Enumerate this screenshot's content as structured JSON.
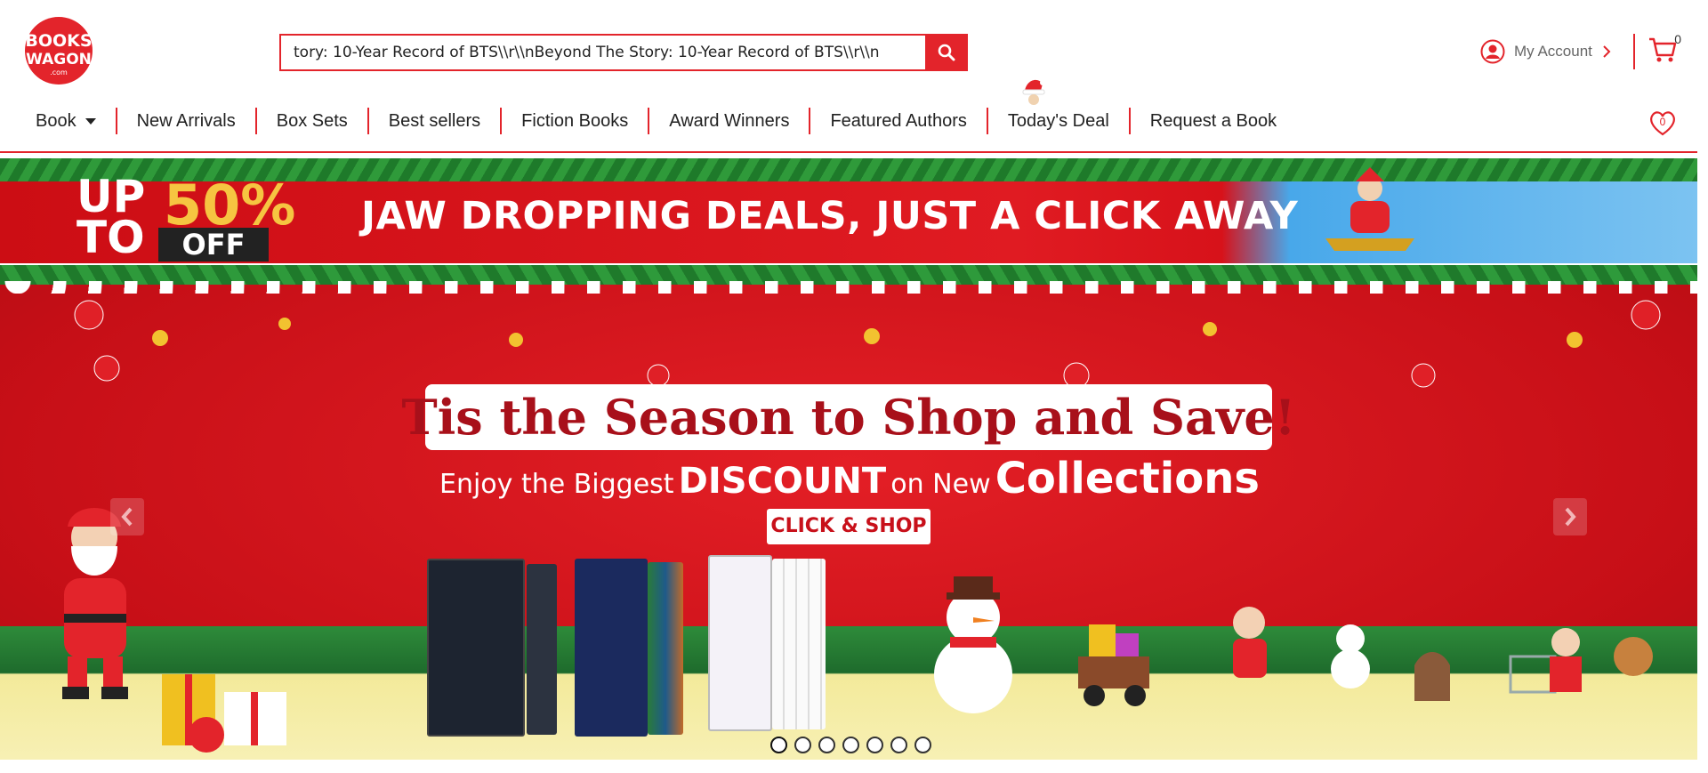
{
  "header": {
    "logo_text": "BOOKS WAGON .com",
    "search_value": "tory: 10-Year Record of BTS\\\\r\\\\nBeyond The Story: 10-Year Record of BTS\\\\r\\\\n",
    "account_label": "My Account",
    "cart_count": "0",
    "wishlist_count": "0"
  },
  "nav": {
    "items": [
      "Book",
      "New Arrivals",
      "Box Sets",
      "Best sellers",
      "Fiction Books",
      "Award Winners",
      "Featured Authors",
      "Today's Deal",
      "Request a Book"
    ]
  },
  "promo": {
    "up": "UP",
    "to": "TO",
    "percent": "50%",
    "off": "OFF",
    "headline": "JAW DROPPING DEALS, JUST A CLICK AWAY"
  },
  "hero": {
    "title": "Tis the Season to Shop and Save!",
    "sub_a": "Enjoy the Biggest",
    "sub_b": "DISCOUNT",
    "sub_c": "on New",
    "sub_d": "Collections",
    "cta": "CLICK & SHOP",
    "slide_count": 7,
    "active_slide": 1
  },
  "colors": {
    "brand_red": "#e3242b",
    "hero_red": "#c70f17",
    "gold": "#f6c541"
  },
  "icons": [
    "search-icon",
    "user-icon",
    "chevron-right-icon",
    "cart-icon",
    "heart-icon",
    "santa-hat-icon",
    "chevron-left-icon"
  ]
}
